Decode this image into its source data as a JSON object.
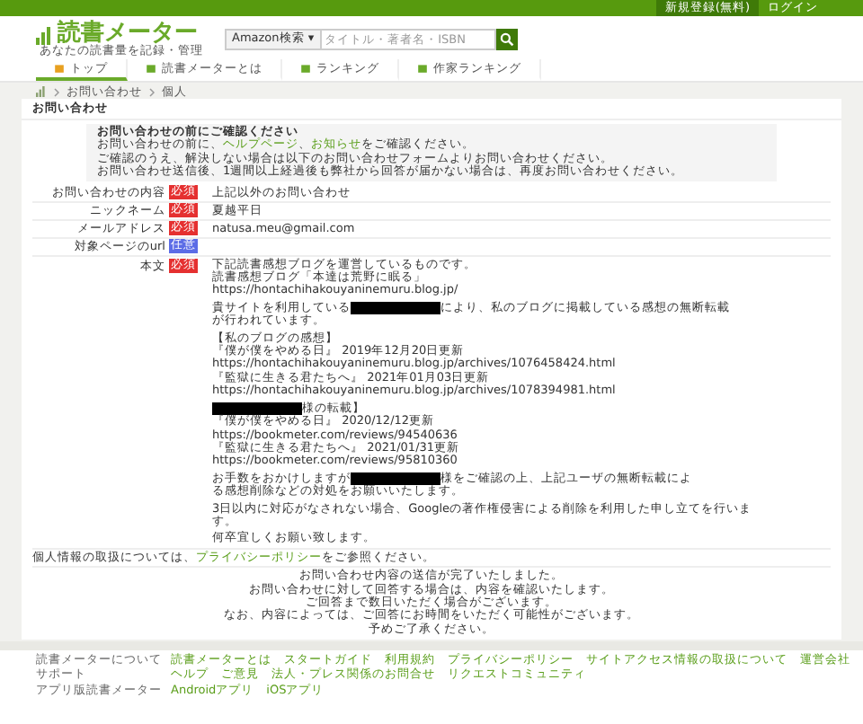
{
  "top_bar": {
    "links": [
      "新規登録(無料)",
      "ログイン"
    ]
  },
  "header": {
    "logo": "読書メーター",
    "tagline": "あなたの読書量を記録・管理",
    "search_scope": "Amazon検索 ▾",
    "search_placeholder": "タイトル・著者名・ISBN"
  },
  "nav": [
    {
      "label": "トップ",
      "selected": true
    },
    {
      "label": "読書メーターとは",
      "selected": false
    },
    {
      "label": "ランキング",
      "selected": false
    },
    {
      "label": "作家ランキング",
      "selected": false
    }
  ],
  "breadcrumb": [
    "お問い合わせ",
    "個人"
  ],
  "card_title": "お問い合わせ",
  "notice": {
    "title": "お問い合わせの前にご確認ください",
    "lines": [
      [
        {
          "kind": "text",
          "text": "お問い合わせの前に、"
        },
        {
          "kind": "link",
          "text": "ヘルプページ"
        },
        {
          "kind": "text",
          "text": "、"
        },
        {
          "kind": "link",
          "text": "お知らせ"
        },
        {
          "kind": "text",
          "text": "をご確認ください。"
        }
      ],
      [
        {
          "kind": "text",
          "text": "ご確認のうえ、解決しない場合は以下のお問い合わせフォームよりお問い合わせください。"
        }
      ],
      [
        {
          "kind": "text",
          "text": "お問い合わせ送信後、1週間以上経過後も弊社から回答が届かない場合は、再度お問い合わせください。"
        }
      ]
    ]
  },
  "fields": [
    {
      "label": "お問い合わせの内容",
      "badge": "必須",
      "required": true,
      "value": "上記以外のお問い合わせ"
    },
    {
      "label": "ニックネーム",
      "badge": "必須",
      "required": true,
      "value": "夏越平日"
    },
    {
      "label": "メールアドレス",
      "badge": "必須",
      "required": true,
      "value": "natusa.meu@gmail.com"
    },
    {
      "label": "対象ページのurl",
      "badge": "任意",
      "required": false
    }
  ],
  "body": {
    "label": "本文",
    "badge": "必須",
    "required": true,
    "paragraphs": [
      [
        [
          {
            "kind": "text",
            "text": "下記読書感想ブログを運営しているものです。"
          }
        ],
        [
          {
            "kind": "text",
            "text": "読書感想ブログ「本達は荒野に眠る」"
          }
        ],
        [
          {
            "kind": "text",
            "text": "https://hontachihakouyaninemuru.blog.jp/"
          }
        ]
      ],
      [
        [
          {
            "kind": "text",
            "text": "貴サイトを利用している"
          },
          {
            "kind": "redacted"
          },
          {
            "kind": "text",
            "text": "により、私のブログに掲載している感想の無断転載"
          }
        ],
        [
          {
            "kind": "text",
            "text": "が行われています。"
          }
        ]
      ],
      [
        [
          {
            "kind": "text",
            "text": "【私のブログの感想】"
          }
        ],
        [
          {
            "kind": "text",
            "text": "『僕が僕をやめる日』 2019年12月20日更新"
          }
        ],
        [
          {
            "kind": "text",
            "text": "https://hontachihakouyaninemuru.blog.jp/archives/1076458424.html"
          }
        ],
        [
          {
            "kind": "text",
            "text": "『監獄に生きる君たちへ』 2021年01月03日更新"
          }
        ],
        [
          {
            "kind": "text",
            "text": "https://hontachihakouyaninemuru.blog.jp/archives/1078394981.html"
          }
        ]
      ],
      [
        [
          {
            "kind": "redacted"
          },
          {
            "kind": "text",
            "text": "様の転載】"
          }
        ],
        [
          {
            "kind": "text",
            "text": "『僕が僕をやめる日』 2020/12/12更新"
          }
        ],
        [
          {
            "kind": "text",
            "text": "https://bookmeter.com/reviews/94540636"
          }
        ],
        [
          {
            "kind": "text",
            "text": "『監獄に生きる君たちへ』 2021/01/31更新"
          }
        ],
        [
          {
            "kind": "text",
            "text": "https://bookmeter.com/reviews/95810360"
          }
        ]
      ],
      [
        [
          {
            "kind": "text",
            "text": "お手数をおかけしますが"
          },
          {
            "kind": "redacted"
          },
          {
            "kind": "text",
            "text": "様をご確認の上、上記ユーザの無断転載によ"
          }
        ],
        [
          {
            "kind": "text",
            "text": "る感想削除などの対処をお願いいたします。"
          }
        ]
      ],
      [
        [
          {
            "kind": "text",
            "text": "3日以内に対応がなされない場合、Googleの著作権侵害による削除を利用した申し立てを行いま"
          }
        ],
        [
          {
            "kind": "text",
            "text": "す。"
          }
        ]
      ],
      [
        [
          {
            "kind": "text",
            "text": "何卒宜しくお願い致します。"
          }
        ]
      ]
    ]
  },
  "privacy": [
    {
      "kind": "text",
      "text": "個人情報の取扱については、"
    },
    {
      "kind": "link",
      "text": "プライバシーポリシー"
    },
    {
      "kind": "text",
      "text": "をご参照ください。"
    }
  ],
  "completion": [
    "お問い合わせ内容の送信が完了いたしました。",
    "お問い合わせに対して回答する場合は、内容を確認いたします。",
    "ご回答まで数日いただく場合がございます。",
    "なお、内容によっては、ご回答にお時間をいただく可能性がございます。",
    "予めご了承ください。"
  ],
  "footer": [
    {
      "heading": "読書メーターについて",
      "links": [
        "読書メーターとは",
        "スタートガイド",
        "利用規約",
        "プライバシーポリシー",
        "サイトアクセス情報の取扱について",
        "運営会社"
      ]
    },
    {
      "heading": "サポート",
      "links": [
        "ヘルプ",
        "ご意見",
        "法人・プレス関係のお問合せ",
        "リクエストコミュニティ"
      ]
    },
    {
      "heading": "アプリ版読書メーター",
      "links": [
        "Androidアプリ",
        "iOSアプリ"
      ]
    }
  ]
}
